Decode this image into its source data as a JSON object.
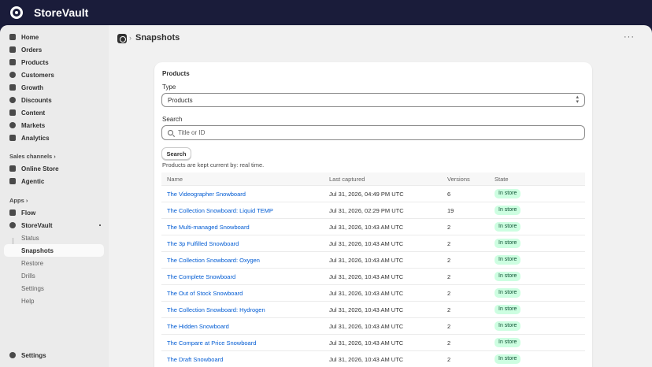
{
  "app": {
    "name": "StoreVault"
  },
  "sidebar": {
    "items": [
      {
        "label": "Home",
        "icon": "home-icon"
      },
      {
        "label": "Orders",
        "icon": "orders-icon"
      },
      {
        "label": "Products",
        "icon": "tag-icon"
      },
      {
        "label": "Customers",
        "icon": "person-icon"
      },
      {
        "label": "Growth",
        "icon": "growth-icon"
      },
      {
        "label": "Discounts",
        "icon": "discount-icon"
      },
      {
        "label": "Content",
        "icon": "content-icon"
      },
      {
        "label": "Markets",
        "icon": "globe-icon"
      },
      {
        "label": "Analytics",
        "icon": "bar-chart-icon"
      }
    ],
    "sales_channels_title": "Sales channels",
    "sales_channels": [
      {
        "label": "Online Store",
        "icon": "store-icon"
      },
      {
        "label": "Agentic",
        "icon": "agent-icon"
      }
    ],
    "apps_title": "Apps",
    "apps": [
      {
        "label": "Flow",
        "icon": "flow-icon"
      },
      {
        "label": "StoreVault",
        "icon": "storevault-icon"
      }
    ],
    "subitems": [
      "Status",
      "Snapshots",
      "Restore",
      "Drills",
      "Settings",
      "Help"
    ],
    "settings_label": "Settings"
  },
  "page": {
    "title": "Snapshots"
  },
  "card": {
    "title": "Products",
    "type_label": "Type",
    "type_value": "Products",
    "search_label": "Search",
    "search_placeholder": "Title or ID",
    "search_button": "Search",
    "hint": "Products are kept current by: real time."
  },
  "table": {
    "headers": [
      "Name",
      "Last captured",
      "Versions",
      "State"
    ],
    "rows": [
      {
        "name": "The Videographer Snowboard",
        "captured": "Jul 31, 2026, 04:49 PM UTC",
        "versions": "6",
        "state": "In store"
      },
      {
        "name": "The Collection Snowboard: Liquid TEMP",
        "captured": "Jul 31, 2026, 02:29 PM UTC",
        "versions": "19",
        "state": "In store"
      },
      {
        "name": "The Multi-managed Snowboard",
        "captured": "Jul 31, 2026, 10:43 AM UTC",
        "versions": "2",
        "state": "In store"
      },
      {
        "name": "The 3p Fulfilled Snowboard",
        "captured": "Jul 31, 2026, 10:43 AM UTC",
        "versions": "2",
        "state": "In store"
      },
      {
        "name": "The Collection Snowboard: Oxygen",
        "captured": "Jul 31, 2026, 10:43 AM UTC",
        "versions": "2",
        "state": "In store"
      },
      {
        "name": "The Complete Snowboard",
        "captured": "Jul 31, 2026, 10:43 AM UTC",
        "versions": "2",
        "state": "In store"
      },
      {
        "name": "The Out of Stock Snowboard",
        "captured": "Jul 31, 2026, 10:43 AM UTC",
        "versions": "2",
        "state": "In store"
      },
      {
        "name": "The Collection Snowboard: Hydrogen",
        "captured": "Jul 31, 2026, 10:43 AM UTC",
        "versions": "2",
        "state": "In store"
      },
      {
        "name": "The Hidden Snowboard",
        "captured": "Jul 31, 2026, 10:43 AM UTC",
        "versions": "2",
        "state": "In store"
      },
      {
        "name": "The Compare at Price Snowboard",
        "captured": "Jul 31, 2026, 10:43 AM UTC",
        "versions": "2",
        "state": "In store"
      },
      {
        "name": "The Draft Snowboard",
        "captured": "Jul 31, 2026, 10:43 AM UTC",
        "versions": "2",
        "state": "In store"
      }
    ]
  },
  "colors": {
    "topbar": "#1a1c3a",
    "link": "#005bd3",
    "badge_bg": "#cdfee1",
    "badge_text": "#0c5132"
  }
}
